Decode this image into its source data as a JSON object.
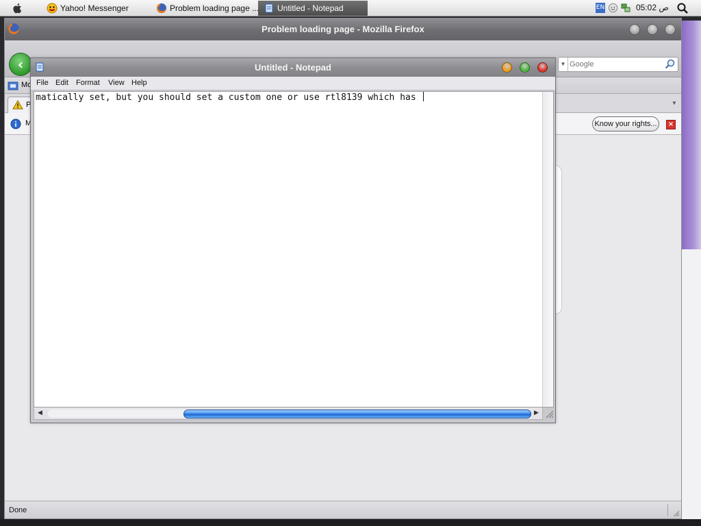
{
  "taskbar": {
    "tasks": [
      {
        "label": "Yahoo! Messenger",
        "icon": "yahoo-messenger-icon"
      },
      {
        "label": "Problem loading page ...",
        "icon": "firefox-icon"
      },
      {
        "label": "Untitled - Notepad",
        "icon": "notepad-icon",
        "active": true
      }
    ],
    "language": "EN",
    "clock": "05:02 ص"
  },
  "firefox": {
    "title": "Problem loading page - Mozilla Firefox",
    "search_placeholder": "Google",
    "bookmark_label": "Mo",
    "tab_label": "P",
    "info_text": "M",
    "know_rights_label": "Know your rights...",
    "status": "Done"
  },
  "notepad": {
    "title": "Untitled - Notepad",
    "menu": [
      "File",
      "Edit",
      "Format",
      "View",
      "Help"
    ],
    "content": "matically set, but you should set a custom one or use rtl8139 which has ",
    "hscroll_position": 0.28,
    "hscroll_visible_fraction": 0.72
  },
  "colors": {
    "notepad_minimize": "#f0a020",
    "notepad_zoom": "#4fb83e",
    "notepad_close": "#e0352b",
    "scroll_thumb": "#3e8ff0"
  }
}
